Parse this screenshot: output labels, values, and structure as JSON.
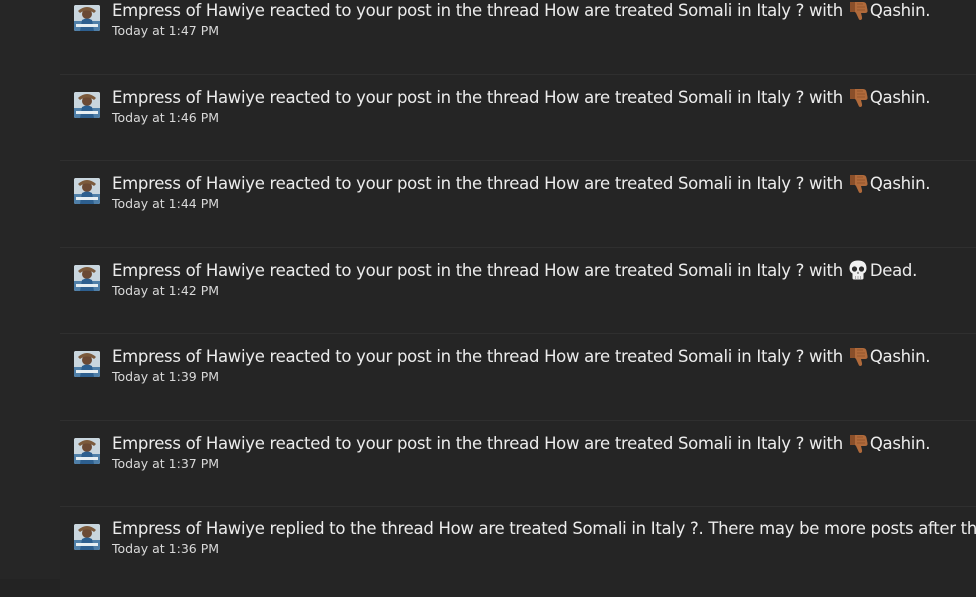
{
  "notifications": [
    {
      "user": "Empress of Hawiye",
      "action": "reacted to your post in the thread",
      "thread": "How are treated Somali in Italy ?",
      "with_text": "with",
      "reaction": "Qashin",
      "reaction_icon": "thumbs-down-icon",
      "end": ".",
      "time": "Today at 1:47 PM"
    },
    {
      "user": "Empress of Hawiye",
      "action": "reacted to your post in the thread",
      "thread": "How are treated Somali in Italy ?",
      "with_text": "with",
      "reaction": "Qashin",
      "reaction_icon": "thumbs-down-icon",
      "end": ".",
      "time": "Today at 1:46 PM"
    },
    {
      "user": "Empress of Hawiye",
      "action": "reacted to your post in the thread",
      "thread": "How are treated Somali in Italy ?",
      "with_text": "with",
      "reaction": "Qashin",
      "reaction_icon": "thumbs-down-icon",
      "end": ".",
      "time": "Today at 1:44 PM"
    },
    {
      "user": "Empress of Hawiye",
      "action": "reacted to your post in the thread",
      "thread": "How are treated Somali in Italy ?",
      "with_text": "with",
      "reaction": "Dead",
      "reaction_icon": "skull-icon",
      "end": ".",
      "time": "Today at 1:42 PM"
    },
    {
      "user": "Empress of Hawiye",
      "action": "reacted to your post in the thread",
      "thread": "How are treated Somali in Italy ?",
      "with_text": "with",
      "reaction": "Qashin",
      "reaction_icon": "thumbs-down-icon",
      "end": ".",
      "time": "Today at 1:39 PM"
    },
    {
      "user": "Empress of Hawiye",
      "action": "reacted to your post in the thread",
      "thread": "How are treated Somali in Italy ?",
      "with_text": "with",
      "reaction": "Qashin",
      "reaction_icon": "thumbs-down-icon",
      "end": ".",
      "time": "Today at 1:37 PM"
    }
  ],
  "last_notification": {
    "user": "Empress of Hawiye",
    "action": "replied to the thread",
    "thread": "How are treated Somali in Italy ?",
    "suffix": ". There may be more posts after this.",
    "time": "Today at 1:36 PM"
  },
  "colors": {
    "background": "#232323",
    "row": "#252525",
    "text": "#ececec",
    "thumbs_down": "#b06a3b"
  }
}
